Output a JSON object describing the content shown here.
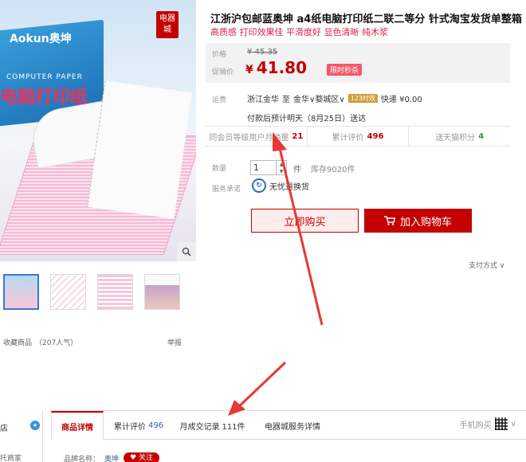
{
  "product": {
    "title": "江浙沪包邮蓝奥坤 a4纸电脑打印纸二联二等分 针式淘宝发货单整箱",
    "subtitle": "高质感 打印效果佳 平滑度好 显色清晰 纯木浆",
    "image_brand": "Aokun奥坤",
    "image_box_text": "COMPUTER PAPER",
    "image_big_text": "电脑打印纸",
    "image_badge": "电器城"
  },
  "price": {
    "label": "价格",
    "original": "¥ 45.35",
    "promo_label": "促销价",
    "currency": "¥",
    "promo_value": "41.80",
    "tag": "限时秒杀"
  },
  "shipping": {
    "label": "运费",
    "origin": "浙江金华",
    "to": "至",
    "dest": "金华∨婺城区∨",
    "badge": "123时效",
    "method": "快递 ¥0.00",
    "eta": "付款后预计明天（8月25日）送达"
  },
  "stats": {
    "sales_label": "同会员等级用户月销量",
    "sales_value": "21",
    "reviews_label": "累计评价",
    "reviews_value": "496",
    "points_label": "送天猫积分",
    "points_value": "4"
  },
  "purchase": {
    "qty_label": "数量",
    "qty_value": "1",
    "unit": "件",
    "stock": "库存9020件",
    "promise_label": "服务承诺",
    "promise_text": "无忧退换货",
    "buy_now": "立即购买",
    "add_cart": "加入购物车",
    "pay_method": "支付方式 ∨"
  },
  "gallery": {
    "favorite_text": "收藏商品",
    "popularity": "（207人气）",
    "report": "举报"
  },
  "store": {
    "name": "店",
    "merchant": "托商家"
  },
  "tabs": [
    {
      "label": "商品详情",
      "count": ""
    },
    {
      "label": "累计评价",
      "count": "496"
    },
    {
      "label": "月成交记录",
      "count": "111件"
    },
    {
      "label": "电器城服务详情",
      "count": ""
    }
  ],
  "mobile_label": "手机购买",
  "brand": {
    "label": "品牌名称：",
    "name": "奥坤",
    "follow": "关注"
  },
  "colors": {
    "accent": "#c40000",
    "promo_red": "#d8224b",
    "annotation_arrow": "#e53935"
  }
}
